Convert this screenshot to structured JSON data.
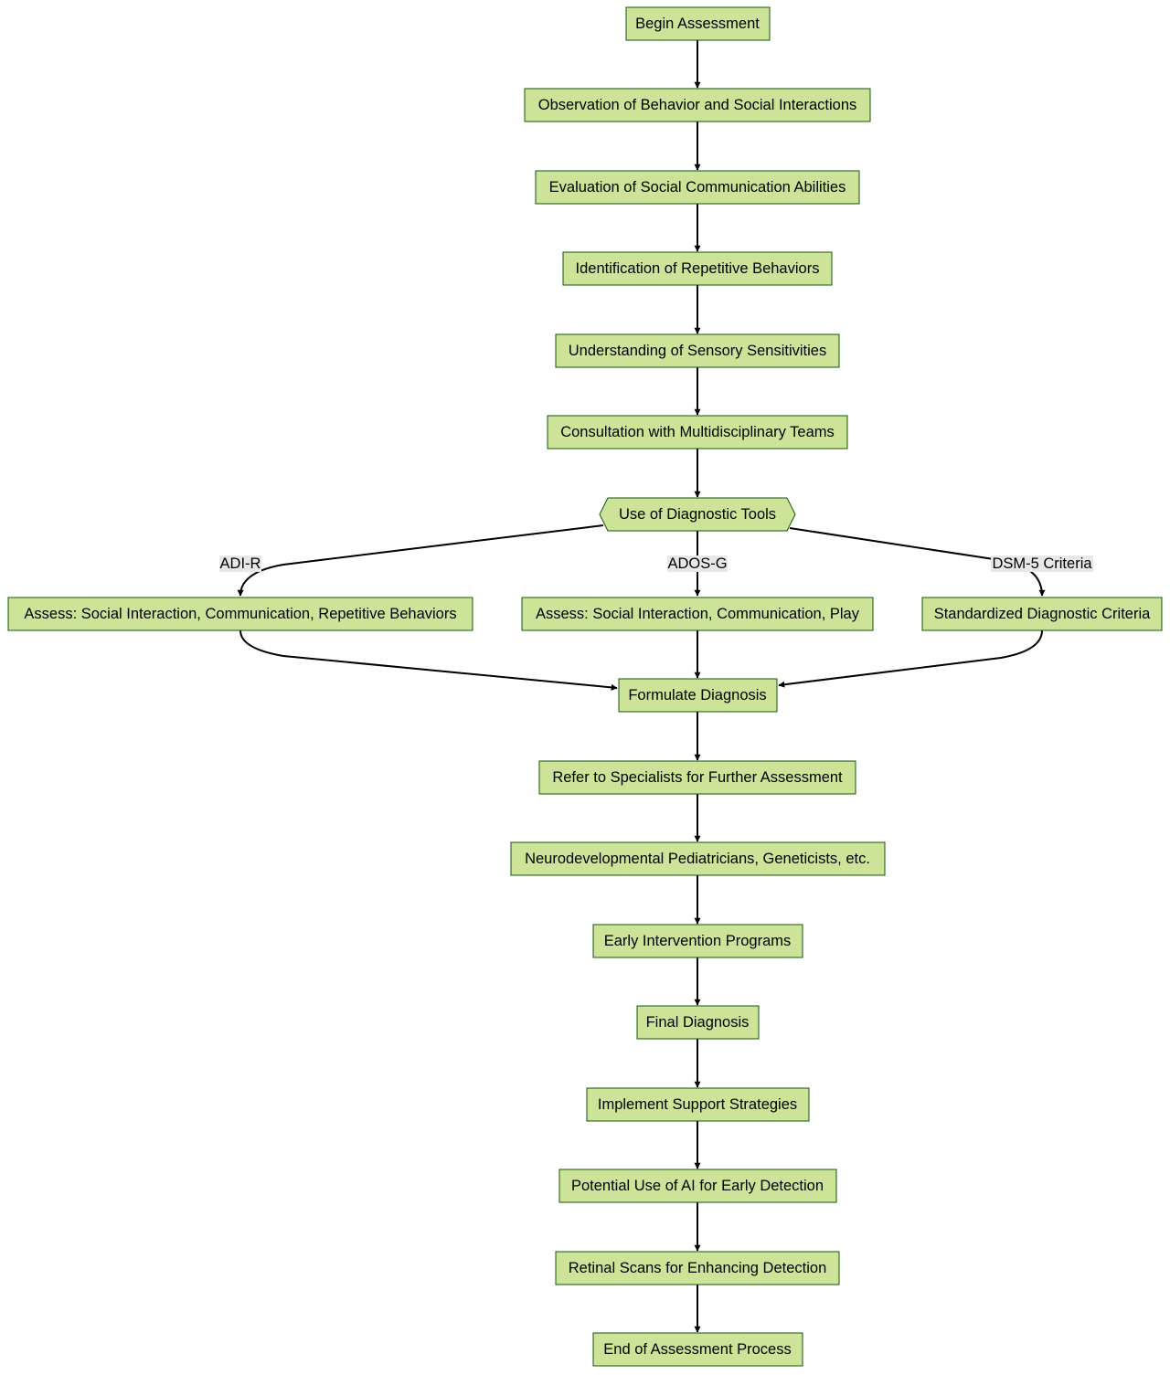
{
  "diagram": {
    "type": "flowchart",
    "colors": {
      "node_fill": "#cde498",
      "node_stroke": "#13540c",
      "edge": "#000000",
      "edge_label_bg": "#e8e8e8"
    },
    "nodes": {
      "begin": "Begin Assessment",
      "observation": "Observation of Behavior and Social Interactions",
      "evaluation": "Evaluation of Social Communication Abilities",
      "identification": "Identification of Repetitive Behaviors",
      "understanding": "Understanding of Sensory Sensitivities",
      "consultation": "Consultation with Multidisciplinary Teams",
      "tools": "Use of Diagnostic Tools",
      "adir_assess": "Assess: Social Interaction, Communication, Repetitive Behaviors",
      "ados_assess": "Assess: Social Interaction, Communication, Play",
      "dsm_criteria": "Standardized Diagnostic Criteria",
      "formulate": "Formulate Diagnosis",
      "refer": "Refer to Specialists for Further Assessment",
      "neuro": "Neurodevelopmental Pediatricians, Geneticists, etc.",
      "early": "Early Intervention Programs",
      "final": "Final Diagnosis",
      "implement": "Implement Support Strategies",
      "ai": "Potential Use of AI for Early Detection",
      "retinal": "Retinal Scans for Enhancing Detection",
      "end": "End of Assessment Process"
    },
    "edge_labels": {
      "adir": "ADI-R",
      "adosg": "ADOS-G",
      "dsm5": "DSM-5 Criteria"
    }
  }
}
